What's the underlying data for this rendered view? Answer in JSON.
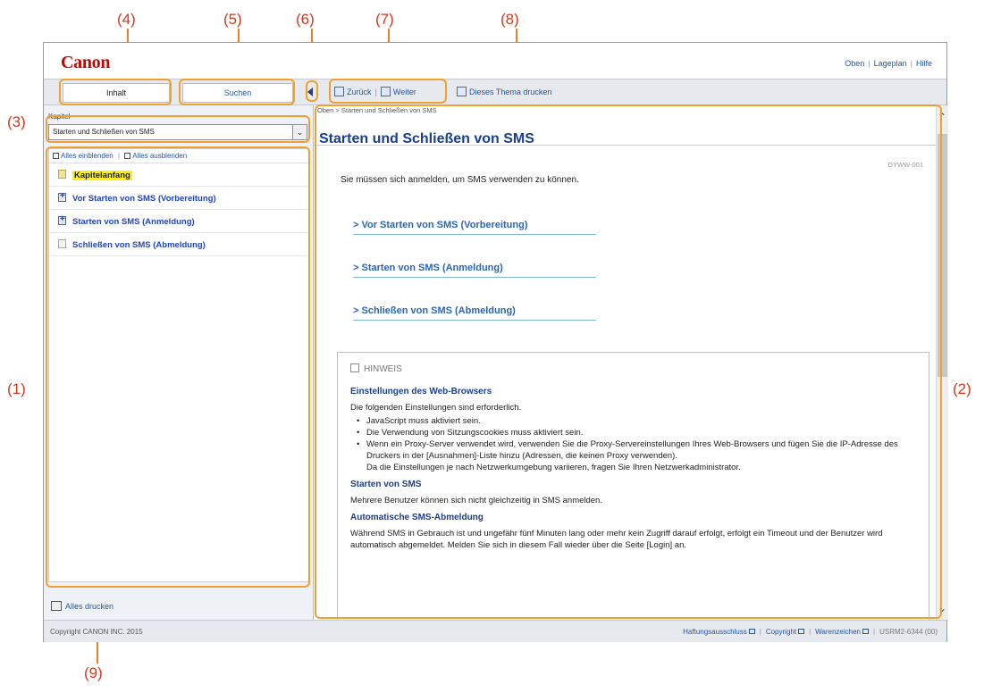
{
  "callouts": {
    "c1": "(1)",
    "c2": "(2)",
    "c3": "(3)",
    "c4": "(4)",
    "c5": "(5)",
    "c6": "(6)",
    "c7": "(7)",
    "c8": "(8)",
    "c9": "(9)"
  },
  "header": {
    "logo": "Canon",
    "links": [
      "Oben",
      "Lageplan",
      "Hilfe"
    ]
  },
  "tabs": {
    "contents": "Inhalt",
    "search": "Suchen"
  },
  "toolbar": {
    "back": "Zurück",
    "forward": "Weiter",
    "print_topic": "Dieses Thema drucken"
  },
  "sidebar": {
    "chapter_label": "Kapitel",
    "chapter_value": "Starten und Schließen von SMS",
    "expand_all": "Alles einblenden",
    "collapse_all": "Alles ausblenden",
    "items": [
      "Kapitelanfang",
      "Vor Starten von SMS (Vorbereitung)",
      "Starten von SMS (Anmeldung)",
      "Schließen von SMS (Abmeldung)"
    ],
    "print_all": "Alles drucken"
  },
  "content": {
    "breadcrumb": "Oben > Starten und Schließen von SMS",
    "title": "Starten und Schließen von SMS",
    "doc_id": "DYWW-001",
    "intro": "Sie müssen sich anmelden, um SMS verwenden zu können.",
    "links": [
      "Vor Starten von SMS (Vorbereitung)",
      "Starten von SMS (Anmeldung)",
      "Schließen von SMS (Abmeldung)"
    ],
    "note": {
      "heading": "HINWEIS",
      "sec1_title": "Einstellungen des Web-Browsers",
      "sec1_text": "Die folgenden Einstellungen sind erforderlich.",
      "sec1_bullets": [
        "JavaScript muss aktiviert sein.",
        "Die Verwendung von Sitzungscookies muss aktiviert sein.",
        "Wenn ein Proxy-Server verwendet wird, verwenden Sie die Proxy-Servereinstellungen Ihres Web-Browsers und fügen Sie die IP-Adresse des Druckers in der [Ausnahmen]-Liste hinzu (Adressen, die keinen Proxy verwenden)."
      ],
      "sec1_followup": "Da die Einstellungen je nach Netzwerkumgebung variieren, fragen Sie Ihren Netzwerkadministrator.",
      "sec2_title": "Starten von SMS",
      "sec2_text": "Mehrere Benutzer können sich nicht gleichzeitig in SMS anmelden.",
      "sec3_title": "Automatische SMS-Abmeldung",
      "sec3_text": "Während SMS in Gebrauch ist und ungefähr fünf Minuten lang oder mehr kein Zugriff darauf erfolgt, erfolgt ein Timeout und der Benutzer wird automatisch abgemeldet. Melden Sie sich in diesem Fall wieder über die Seite [Login] an."
    }
  },
  "footer": {
    "copyright": "Copyright CANON INC. 2015",
    "links": [
      "Haftungsausschluss",
      "Copyright",
      "Warenzeichen"
    ],
    "code": "USRM2-6344 (00)"
  },
  "colors": {
    "callout": "#d6381c",
    "highlight_box": "#f0a030",
    "brand": "#cc0000",
    "link": "#2255aa",
    "title": "#1a3f8f"
  }
}
